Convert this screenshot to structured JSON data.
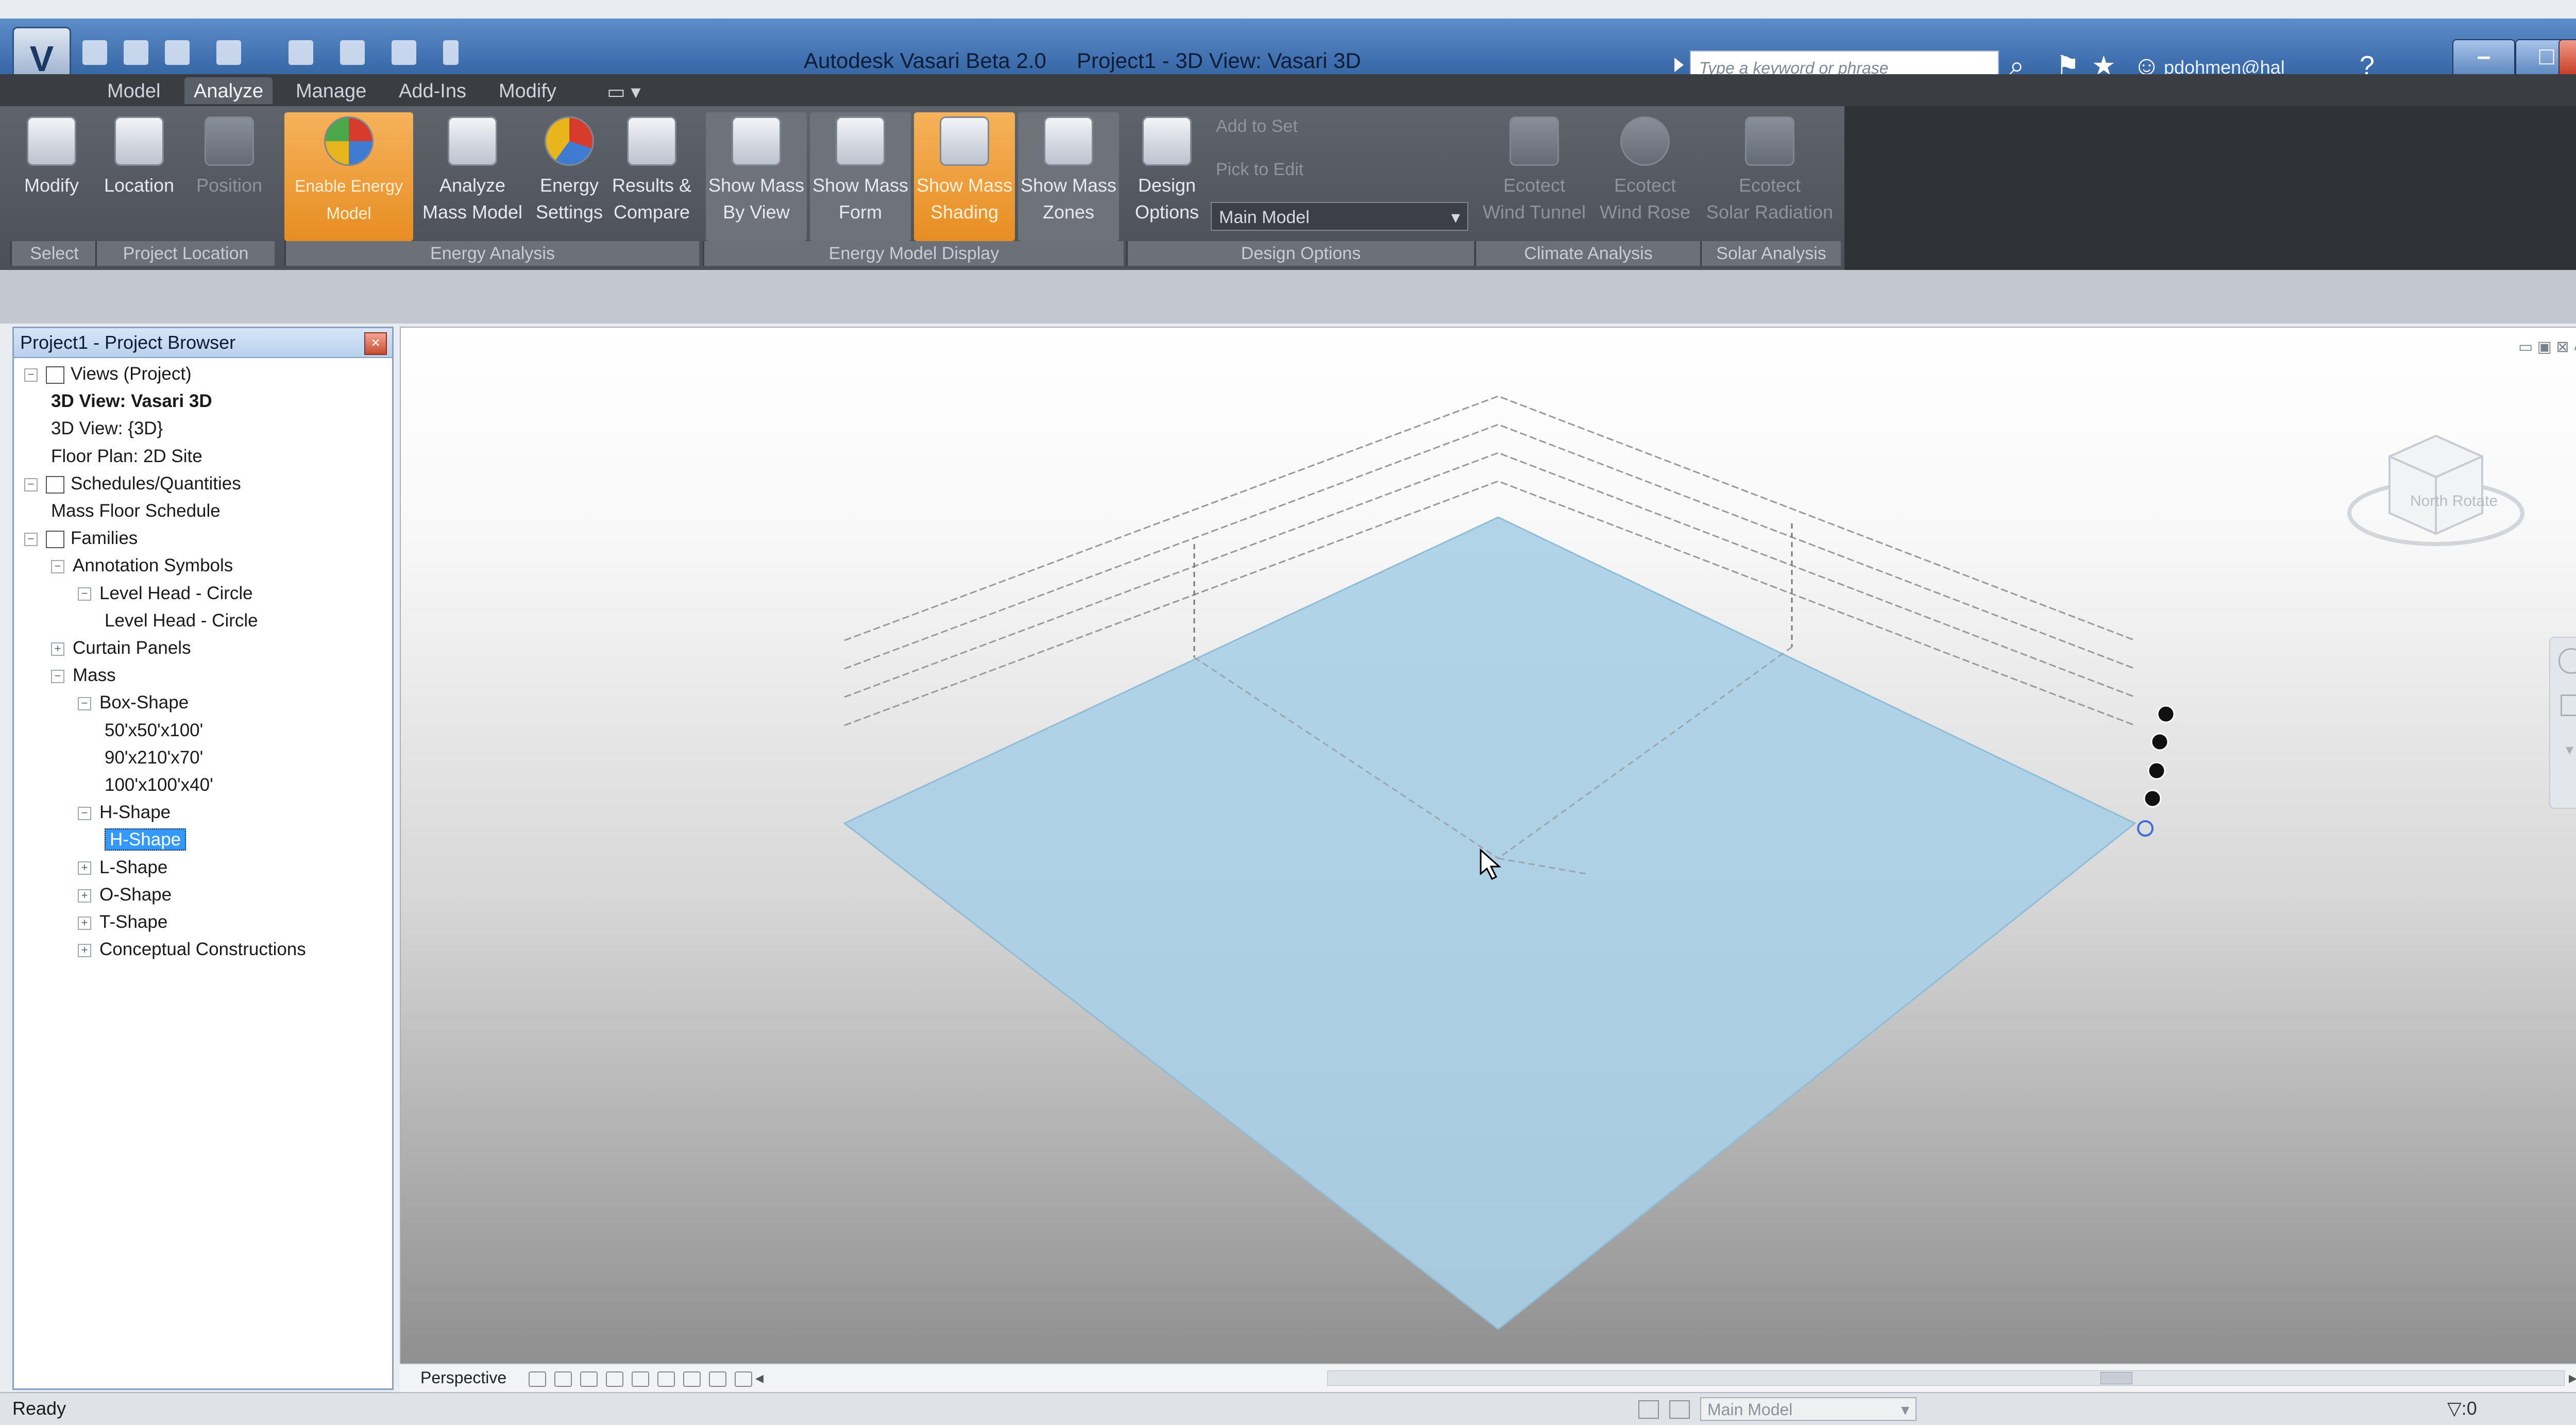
{
  "window": {
    "app_title": "Autodesk Vasari Beta 2.0",
    "view_title": "Project1 - 3D View: Vasari 3D",
    "search_placeholder": "Type a keyword or phrase",
    "user": "pdohmen@hal",
    "minimize": "–",
    "maximize": "□",
    "close": "X"
  },
  "ribbon_tabs": [
    "Model",
    "Analyze",
    "Manage",
    "Add-Ins",
    "Modify"
  ],
  "ribbon_active_tab": "Analyze",
  "ribbon_buttons": {
    "modify": "Modify",
    "location": "Location",
    "position": "Position",
    "enable_energy_model": "Enable Energy Model",
    "analyze_mass_model": [
      "Analyze",
      "Mass Model"
    ],
    "energy_settings": [
      "Energy",
      "Settings"
    ],
    "results_compare": [
      "Results &",
      "Compare"
    ],
    "show_mass_by_view": [
      "Show Mass",
      "By View"
    ],
    "show_mass_form": [
      "Show Mass",
      "Form"
    ],
    "show_mass_shading": [
      "Show Mass",
      "Shading"
    ],
    "show_mass_zones": [
      "Show Mass",
      "Zones"
    ],
    "design_options": [
      "Design",
      "Options"
    ],
    "add_to_set": "Add to Set",
    "pick_to_edit": "Pick to Edit",
    "main_model": "Main Model",
    "ecotect_wind_tunnel": [
      "Ecotect",
      "Wind Tunnel"
    ],
    "ecotect_wind_rose": [
      "Ecotect",
      "Wind Rose"
    ],
    "ecotect_solar_radiation": [
      "Ecotect",
      "Solar Radiation"
    ]
  },
  "ribbon_panels": [
    "Select",
    "Project Location",
    "Energy Analysis",
    "Energy Model Display",
    "Design Options",
    "Climate Analysis",
    "Solar Analysis"
  ],
  "project_browser": {
    "title": "Project1 - Project Browser",
    "close": "×",
    "tree": [
      {
        "label": "Views (Project)",
        "level": 0,
        "expander": "−",
        "icon": "views-icon"
      },
      {
        "label": "3D View: Vasari 3D",
        "level": 1,
        "bold": true
      },
      {
        "label": "3D View: {3D}",
        "level": 1
      },
      {
        "label": "Floor Plan: 2D Site",
        "level": 1
      },
      {
        "label": "Schedules/Quantities",
        "level": 0,
        "expander": "−",
        "icon": "schedule-icon"
      },
      {
        "label": "Mass Floor Schedule",
        "level": 1
      },
      {
        "label": "Families",
        "level": 0,
        "expander": "−",
        "icon": "families-icon"
      },
      {
        "label": "Annotation Symbols",
        "level": 1,
        "expander": "−"
      },
      {
        "label": "Level Head - Circle",
        "level": 2,
        "expander": "−"
      },
      {
        "label": "Level Head - Circle",
        "level": 3
      },
      {
        "label": "Curtain Panels",
        "level": 1,
        "expander": "+"
      },
      {
        "label": "Mass",
        "level": 1,
        "expander": "−"
      },
      {
        "label": "Box-Shape",
        "level": 2,
        "expander": "−"
      },
      {
        "label": "50'x50'x100'",
        "level": 3
      },
      {
        "label": "90'x210'x70'",
        "level": 3
      },
      {
        "label": "100'x100'x40'",
        "level": 3
      },
      {
        "label": "H-Shape",
        "level": 2,
        "expander": "−"
      },
      {
        "label": "H-Shape",
        "level": 3,
        "selected": true
      },
      {
        "label": "L-Shape",
        "level": 2,
        "expander": "+"
      },
      {
        "label": "O-Shape",
        "level": 2,
        "expander": "+"
      },
      {
        "label": "T-Shape",
        "level": 2,
        "expander": "+"
      },
      {
        "label": "Conceptual Constructions",
        "level": 2,
        "expander": "+"
      }
    ]
  },
  "viewport": {
    "viewcube_label": "North Rotate",
    "controls": "▭ ▣ ⊠ ˄",
    "plane_color": "#a9cfe6",
    "level_line_color": "#9a9a9a"
  },
  "view_control": {
    "mode": "Perspective"
  },
  "status_bar": {
    "text": "Ready",
    "model": "Main Model",
    "filter": "▽:0"
  }
}
